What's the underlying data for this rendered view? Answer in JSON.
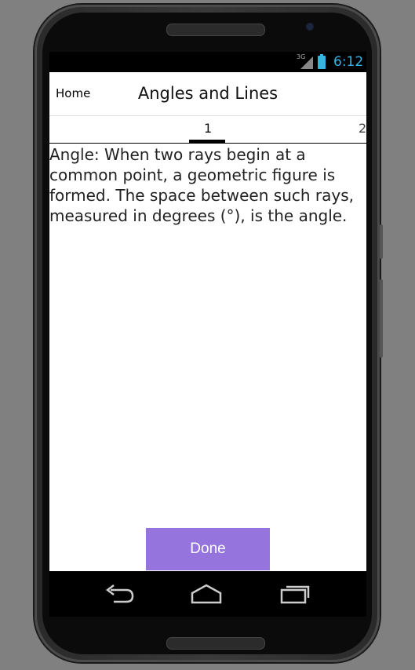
{
  "status_bar": {
    "network": "3G",
    "time": "6:12"
  },
  "action_bar": {
    "home_label": "Home",
    "title": "Angles and Lines"
  },
  "tabs": [
    {
      "label": "1"
    },
    {
      "label": "2"
    }
  ],
  "content": {
    "text": "Angle: When two rays begin at a common point, a geometric figure is formed. The space between such rays, measured in degrees (°), is the angle."
  },
  "done_label": "Done",
  "colors": {
    "accent": "#33b5e5",
    "done_button": "#9575dd"
  },
  "nav_icons": [
    "back-icon",
    "home-icon",
    "recent-apps-icon"
  ]
}
